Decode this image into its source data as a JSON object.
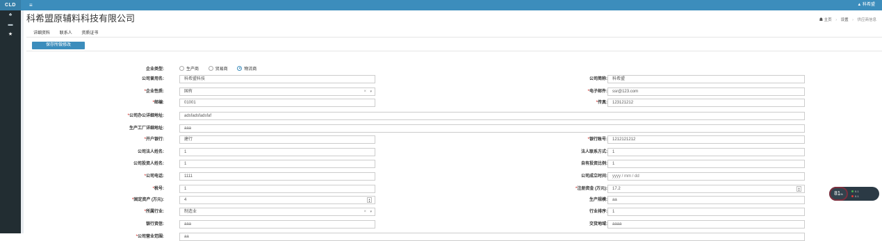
{
  "topbar": {
    "brand": "CLD",
    "menu_icon": "≡",
    "user": "▲ 科希盟"
  },
  "sidebar": {
    "items": [
      {
        "icon": "♣"
      },
      {
        "icon": "▬"
      },
      {
        "icon": "★"
      }
    ]
  },
  "page": {
    "title": "科希盟原辅料科技有限公司"
  },
  "breadcrumb": {
    "home": "主页",
    "sep": "›",
    "settings": "设置",
    "current": "供应商信息"
  },
  "tabs": [
    "详细资料",
    "联系人",
    "资质证书"
  ],
  "save_button": "保存所做修改",
  "form": {
    "enterprise_type": {
      "label": "企业类型:",
      "options": [
        "生产商",
        "贸易商",
        "物流商"
      ],
      "selected": 2
    },
    "company_name": {
      "label": "公司曾用名:",
      "value": "科希盟科技"
    },
    "company_short": {
      "label": "公司简称:",
      "value": "科希盟"
    },
    "enterprise_nature": {
      "label": "企业性质:",
      "value": "国有"
    },
    "email": {
      "label": "电子邮件:",
      "value": "ssr@123.com"
    },
    "postcode": {
      "label": "邮编:",
      "value": "01001"
    },
    "fax": {
      "label": "传真:",
      "value": "123121212"
    },
    "office_address": {
      "label": "公司办公详细地址:",
      "value": "adsfadsfadsfaf"
    },
    "factory_address": {
      "label": "生产工厂详细地址:",
      "value": "aaa"
    },
    "bank": {
      "label": "开户银行:",
      "value": "建行"
    },
    "bank_account": {
      "label": "银行账号:",
      "value": "1212121212"
    },
    "legal_person": {
      "label": "公司法人姓名:",
      "value": "1"
    },
    "legal_contact": {
      "label": "法人联系方式:",
      "value": "1"
    },
    "investor_name": {
      "label": "公司投资人姓名:",
      "value": "1"
    },
    "own_investment": {
      "label": "自有投资比例:",
      "value": "1"
    },
    "company_phone": {
      "label": "公司电话:",
      "value": "1111"
    },
    "founded_date": {
      "label": "公司成立时间:",
      "placeholder": "yyyy / mm / dd"
    },
    "tax_no": {
      "label": "税号:",
      "value": "1"
    },
    "registered_capital": {
      "label": "注册资金 (万元):",
      "value": "17.2"
    },
    "fixed_assets": {
      "label": "固定资产 (万元):",
      "value": "4"
    },
    "production_scale": {
      "label": "生产规模:",
      "value": "aa"
    },
    "industry": {
      "label": "所属行业:",
      "value": "制造业"
    },
    "industry_rank": {
      "label": "行业排序:",
      "value": "1"
    },
    "bank_credit": {
      "label": "银行资信:",
      "value": "aaa"
    },
    "delivery_area": {
      "label": "交货地域:",
      "value": "aaaa"
    },
    "business_scope": {
      "label": "公司营业范围:",
      "value": "aa"
    }
  },
  "gauge": {
    "value": "81",
    "unit": "%",
    "line1": "0.1",
    "line2": "0.1"
  },
  "colors": {
    "accent": "#3c8dbc",
    "required": "#d9534f",
    "sidebar": "#222d32"
  }
}
